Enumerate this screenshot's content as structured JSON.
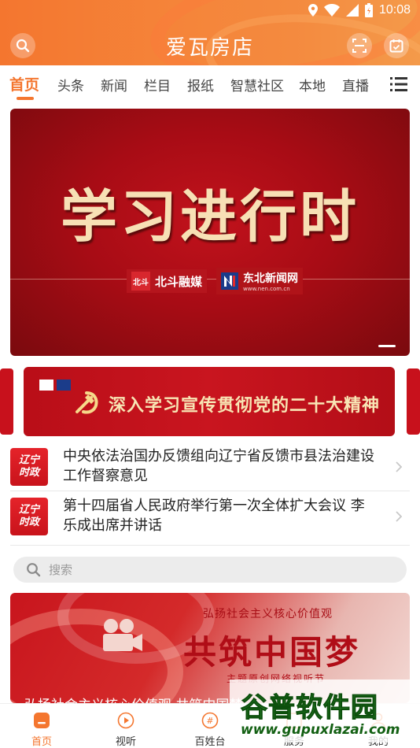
{
  "status_bar": {
    "time": "10:08"
  },
  "header": {
    "title": "爱瓦房店"
  },
  "tabs": [
    {
      "label": "首页",
      "active": true
    },
    {
      "label": "头条"
    },
    {
      "label": "新闻"
    },
    {
      "label": "栏目"
    },
    {
      "label": "报纸"
    },
    {
      "label": "智慧社区"
    },
    {
      "label": "本地"
    },
    {
      "label": "直播"
    }
  ],
  "banner": {
    "title": "学习进行时",
    "logo1_mark": "北斗",
    "logo1_text": "北斗融媒",
    "logo2_text": "东北新闻网",
    "logo2_url": "www.nen.com.cn"
  },
  "promo_strip": {
    "text": "深入学习宣传贯彻党的二十大精神"
  },
  "news": [
    {
      "badge_line1": "辽宁",
      "badge_line2": "时政",
      "title": "中央依法治国办反馈组向辽宁省反馈市县法治建设工作督察意见"
    },
    {
      "badge_line1": "辽宁",
      "badge_line2": "时政",
      "title": "第十四届省人民政府举行第一次全体扩大会议 李乐成出席并讲话"
    }
  ],
  "search": {
    "placeholder": "搜索"
  },
  "banner2": {
    "subtitle": "弘扬社会主义核心价值观",
    "title": "共筑中国梦",
    "tag": "主题原创网络视听节",
    "caption": "弘扬社会主义核心价值观 共筑中国梦"
  },
  "bottom_nav": [
    {
      "label": "首页",
      "icon": "home-icon",
      "active": true
    },
    {
      "label": "视听",
      "icon": "play-icon"
    },
    {
      "label": "百姓台",
      "icon": "hashtag-icon"
    },
    {
      "label": "服务",
      "icon": "service-icon"
    },
    {
      "label": "我的",
      "icon": "user-icon"
    }
  ],
  "watermark": {
    "name": "谷普软件园",
    "url": "www.gupuxlazai.com"
  },
  "colors": {
    "accent": "#f4762f",
    "banner_red": "#a80c15",
    "badge_red": "#d8232a"
  }
}
